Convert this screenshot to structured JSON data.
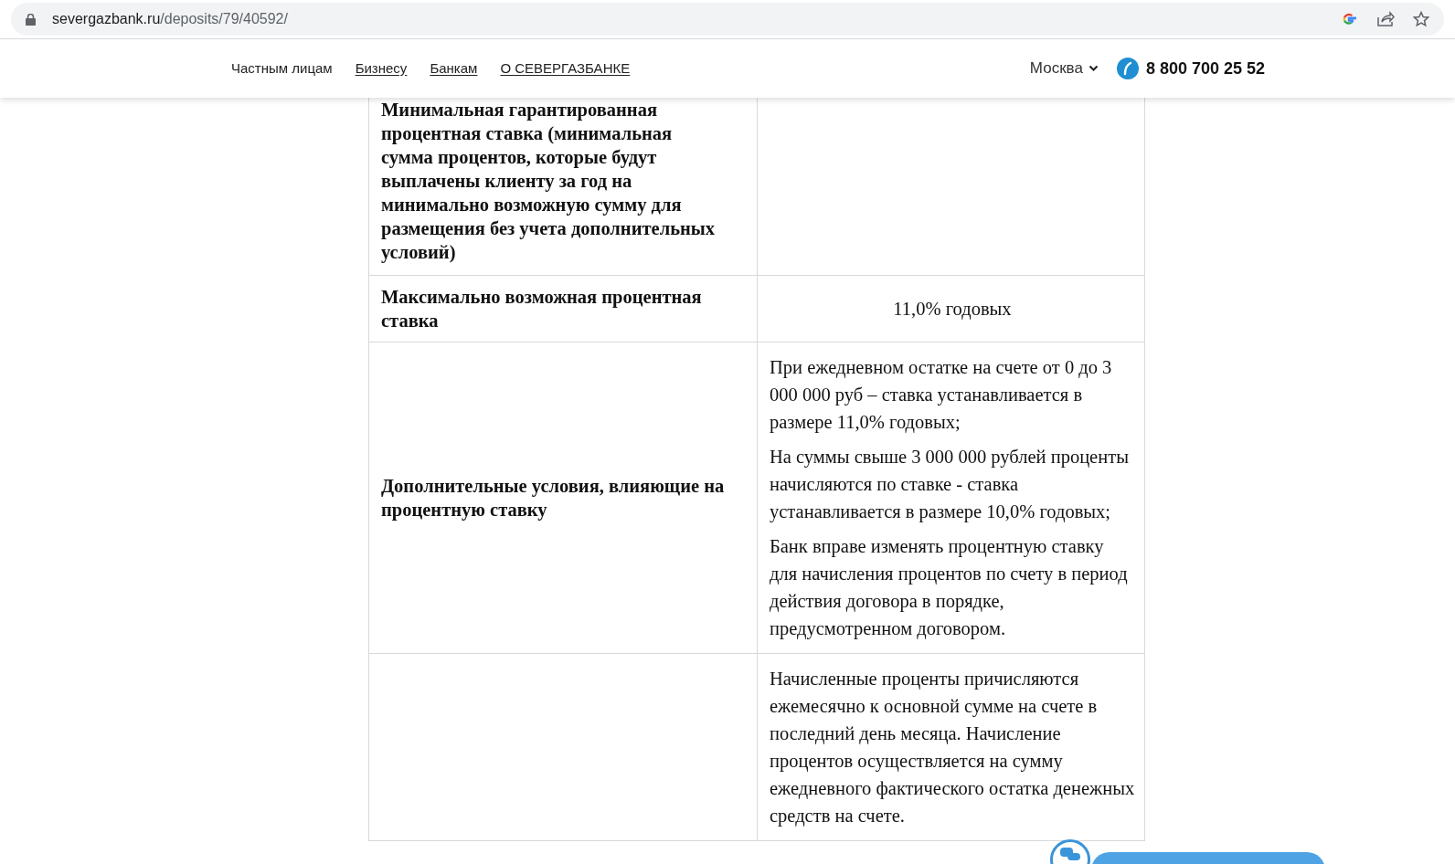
{
  "browser": {
    "url_host": "severgazbank.ru",
    "url_path": "/deposits/79/40592/"
  },
  "nav": [
    {
      "label": "Частным лицам",
      "underlined": false
    },
    {
      "label": "Бизнесу",
      "underlined": true
    },
    {
      "label": "Банкам",
      "underlined": true
    },
    {
      "label": "О СЕВЕРГАЗБАНКЕ",
      "underlined": true
    }
  ],
  "city": "Москва",
  "phone": "8 800 700 25 52",
  "rows": [
    {
      "kind": "text",
      "label": "Минимальная гарантированная процентная ставка (минимальная сумма процентов, которые будут выплачены клиенту за год на минимально возможную сумму для размещения без учета дополнительных условий)",
      "paragraphs": []
    },
    {
      "kind": "centered",
      "label": "Максимально возможная процентная ставка",
      "paragraphs": [
        "11,0% годовых"
      ]
    },
    {
      "kind": "text",
      "label": "Дополнительные условия, влияющие на процентную ставку",
      "paragraphs": [
        "При ежедневном остатке на счете от 0 до 3 000 000 руб – ставка устанавливается в размере 11,0% годовых;",
        "На суммы свыше 3 000 000 рублей проценты начисляются по ставке - ставка устанавливается в размере 10,0% годовых;",
        "Банк вправе изменять процентную ставку для начисления процентов по счету в период действия договора в порядке, предусмотренном договором."
      ]
    },
    {
      "kind": "text",
      "paragraphs": [
        "Начисленные проценты причисляются ежемесячно к основной сумме на счете в последний день месяца. Начисление процентов осуществляется на сумму ежедневного фактического остатка денежных средств на счете."
      ]
    }
  ]
}
